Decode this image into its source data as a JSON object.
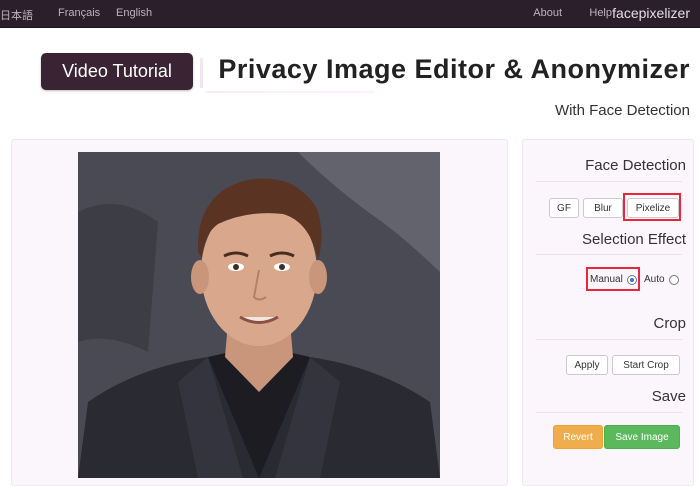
{
  "navbar": {
    "brand": "facepixelizer",
    "links": [
      "Help",
      "About",
      "English",
      "Français",
      "日本語"
    ]
  },
  "header": {
    "video_button": "Video Tutorial",
    "title": "Privacy Image Editor & Anonymizer",
    "subtitle": "With Face Detection"
  },
  "controls": {
    "face_detection": {
      "title": "Face Detection",
      "buttons": [
        "Pixelize",
        "Blur",
        "GF"
      ]
    },
    "selection_effect": {
      "title": "Selection Effect",
      "options": [
        "Auto",
        "Manual"
      ],
      "selected": "Manual"
    },
    "crop": {
      "title": "Crop",
      "buttons": [
        "Start Crop",
        "Apply"
      ]
    },
    "save": {
      "title": "Save",
      "save_button": "Save Image",
      "revert_button": "Revert"
    }
  },
  "colors": {
    "navbar_bg": "#2b1f2b",
    "video_button_bg": "#3a2433",
    "highlight": "#e8263c",
    "save_green": "#5cb85c",
    "revert_orange": "#f0ad4e"
  }
}
